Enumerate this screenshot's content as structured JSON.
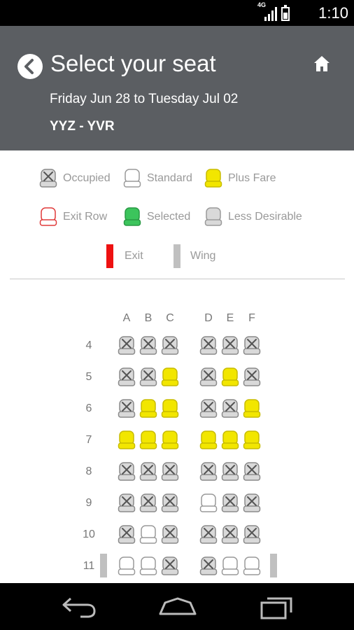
{
  "status_bar": {
    "network": "4G",
    "time": "1:10"
  },
  "header": {
    "title": "Select your seat",
    "dates": "Friday Jun 28 to Tuesday Jul 02",
    "route": "YYZ - YVR"
  },
  "legend": {
    "occupied": "Occupied",
    "standard": "Standard",
    "plus_fare": "Plus Fare",
    "exit_row": "Exit Row",
    "selected": "Selected",
    "less_desirable": "Less Desirable",
    "exit": "Exit",
    "wing": "Wing"
  },
  "colors": {
    "header_bg": "#5b5e62",
    "plus_fare": "#f2e600",
    "selected": "#3cc45c",
    "exit_row": "#e03a3a",
    "exit_marker": "#ee1111",
    "wing_marker": "#c0c0c0"
  },
  "seat_map": {
    "columns": [
      "A",
      "B",
      "C",
      "D",
      "E",
      "F"
    ],
    "rows": [
      {
        "row": "4",
        "seats": [
          "occupied",
          "occupied",
          "occupied",
          "occupied",
          "occupied",
          "occupied"
        ],
        "wing": false
      },
      {
        "row": "5",
        "seats": [
          "occupied",
          "occupied",
          "plus",
          "occupied",
          "plus",
          "occupied"
        ],
        "wing": false
      },
      {
        "row": "6",
        "seats": [
          "occupied",
          "plus",
          "plus",
          "occupied",
          "occupied",
          "plus"
        ],
        "wing": false
      },
      {
        "row": "7",
        "seats": [
          "plus",
          "plus",
          "plus",
          "plus",
          "plus",
          "plus"
        ],
        "wing": false
      },
      {
        "row": "8",
        "seats": [
          "occupied",
          "occupied",
          "occupied",
          "occupied",
          "occupied",
          "occupied"
        ],
        "wing": false
      },
      {
        "row": "9",
        "seats": [
          "occupied",
          "occupied",
          "occupied",
          "standard",
          "occupied",
          "occupied"
        ],
        "wing": false
      },
      {
        "row": "10",
        "seats": [
          "occupied",
          "standard",
          "occupied",
          "occupied",
          "occupied",
          "occupied"
        ],
        "wing": false
      },
      {
        "row": "11",
        "seats": [
          "standard",
          "standard",
          "occupied",
          "occupied",
          "standard",
          "standard"
        ],
        "wing": true
      }
    ]
  },
  "nav_bar": {
    "icons": [
      "back-icon",
      "home-icon",
      "recent-apps-icon"
    ]
  }
}
